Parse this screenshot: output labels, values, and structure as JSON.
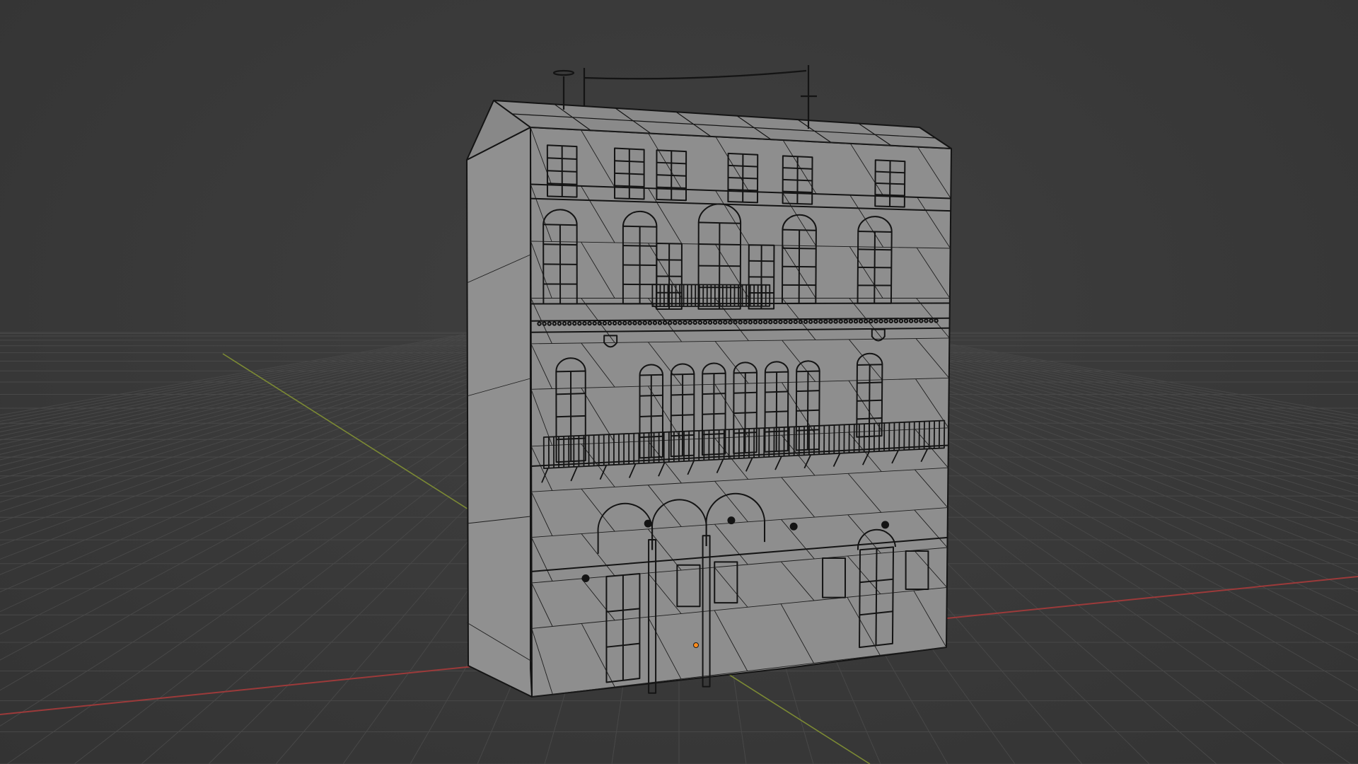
{
  "viewport": {
    "background_color": "#393939",
    "grid_color": "#4a4a4a",
    "x_axis_color": "#a63a3a",
    "y_axis_color": "#8a9a3a",
    "object_face_color": "#8f8f8f",
    "object_wire_color": "#141414",
    "origin_color": "#ff8c1a"
  },
  "object": {
    "name": "building",
    "shading": "solid-wireframe",
    "floors": 4,
    "features": [
      "gable-roof",
      "rooftop-antennas",
      "rectangular-windows",
      "arched-windows",
      "balcony-upper",
      "balcony-long",
      "arcade-arches",
      "double-doors",
      "coat-of-arms"
    ]
  }
}
